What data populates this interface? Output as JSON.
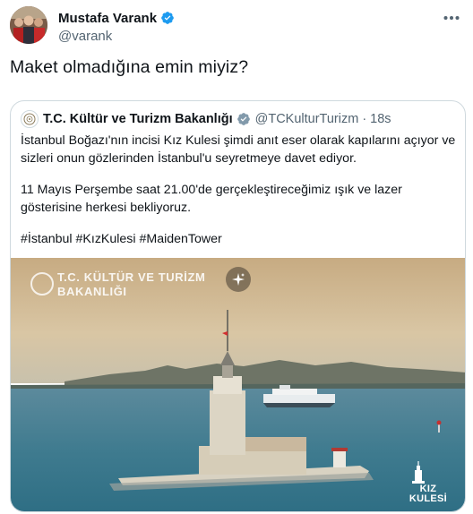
{
  "tweet": {
    "author": {
      "name": "Mustafa Varank",
      "handle": "@varank",
      "avatar_icon": "avatar-photo"
    },
    "text": "Maket olmadığına emin miyiz?",
    "more_icon": "more-horizontal-icon",
    "verified_color": "#1d9bf0"
  },
  "quote": {
    "author": {
      "name": "T.C. Kültür ve Turizm Bakanlığı",
      "handle": "@TCKulturTurizm",
      "separator": "·",
      "time": "18s",
      "badge_icon": "gray-checkmark-badge-icon"
    },
    "paragraphs": [
      "İstanbul Boğazı'nın incisi Kız Kulesi şimdi anıt eser olarak kapılarını açıyor ve sizleri onun gözlerinden İstanbul'u seyretmeye davet ediyor.",
      "11 Mayıs Perşembe saat 21.00'de gerçekleştireceğimiz ışık ve lazer gösterisine herkesi bekliyoruz.",
      "#İstanbul #KızKulesi #MaidenTower"
    ],
    "media": {
      "watermark_line1": "T.C. KÜLTÜR VE TURİZM",
      "watermark_line2": "BAKANLIĞI",
      "logo_line1": "KIZ",
      "logo_line2": "KULESİ",
      "sparkle_icon": "sparkle-icon"
    }
  }
}
